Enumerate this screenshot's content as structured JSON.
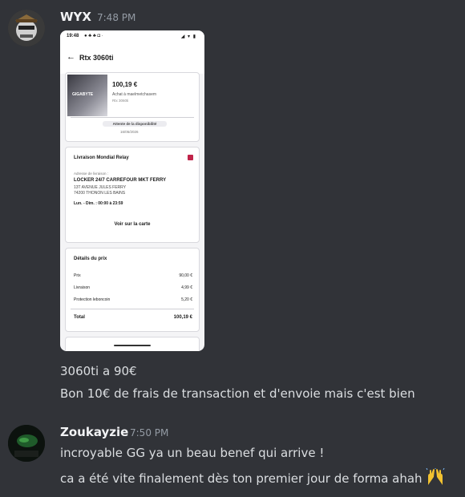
{
  "messages": [
    {
      "author": "WYX",
      "time": "7:48 PM",
      "lines": [
        "3060ti a 90€",
        "Bon 10€ de frais de transaction et d'envoie mais c'est bien"
      ],
      "attachment": {
        "status_time": "19:48",
        "status_icons": "◢ ▾ ▮",
        "title": "Rtx 3060ti",
        "brand_text": "GIGABYTE",
        "price": "100,19 €",
        "sub1": "Achat à maelmetchasem",
        "sub2": "Rtx 3060ti",
        "pill": "Attente de la disponibilité",
        "date": "16/05/2026",
        "delivery_title": "Livraison Mondial Relay",
        "address_label": "Adresse de livraison :",
        "address_name": "LOCKER 24/7 CARREFOUR MKT FERRY",
        "address_line1": "13T AVENUE JULES FERRY",
        "address_line2": "74200 THONON LES BAINS",
        "hours": "Lun. - Dim. : 00:00 à 23:59",
        "map_link": "Voir sur la carte",
        "price_title": "Détails du prix",
        "price_rows": [
          {
            "label": "Prix",
            "value": "90,00 €"
          },
          {
            "label": "Livraison",
            "value": "4,99 €"
          },
          {
            "label": "Protection leboncoin",
            "value": "5,20 €"
          }
        ],
        "total_label": "Total",
        "total_value": "100,19 €"
      }
    },
    {
      "author": "Zoukayzie",
      "time": "7:50 PM",
      "lines": [
        "incroyable GG ya un beau benef qui arrive !",
        "ca a été vite finalement dès ton premier jour de forma ahah"
      ],
      "emoji": "raising-hands"
    }
  ],
  "colors": {
    "background": "#313338",
    "username": "#f2f3f5",
    "text": "#dbdee1",
    "timestamp": "#949ba4",
    "badge": "#c0244a"
  }
}
